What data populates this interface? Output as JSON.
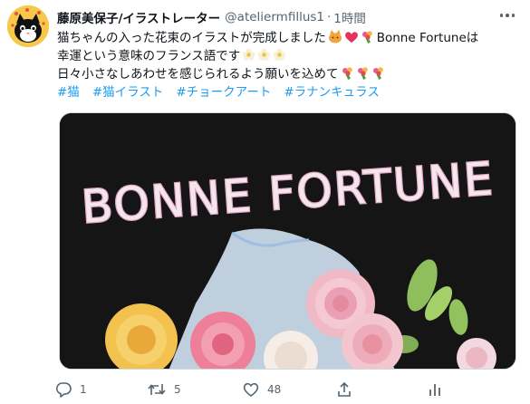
{
  "tweet": {
    "author_name": "藤原美保子/イラストレーター",
    "handle": "@ateliermfillus1",
    "separator": "·",
    "time": "1時間",
    "lines": [
      "猫ちゃんの入った花束のイラストが完成しました",
      "Bonne Fortuneは",
      "幸運という意味のフランス語です",
      "日々小さなしあわせを感じられるよう願いを込めて"
    ],
    "hashtags": [
      "#猫",
      "#猫イラスト",
      "#チョークアート",
      "#ラナンキュラス"
    ],
    "media_title": "BONNE FORTUNE"
  },
  "actions": {
    "reply_count": "1",
    "retweet_count": "5",
    "like_count": "48"
  },
  "icons": {
    "more": "more-dots-icon",
    "reply": "reply-icon",
    "retweet": "retweet-icon",
    "like": "heart-icon",
    "share": "share-icon",
    "analytics": "analytics-icon"
  },
  "colors": {
    "link": "#1d9bf0",
    "secondary": "#536471",
    "text": "#0f1419"
  }
}
